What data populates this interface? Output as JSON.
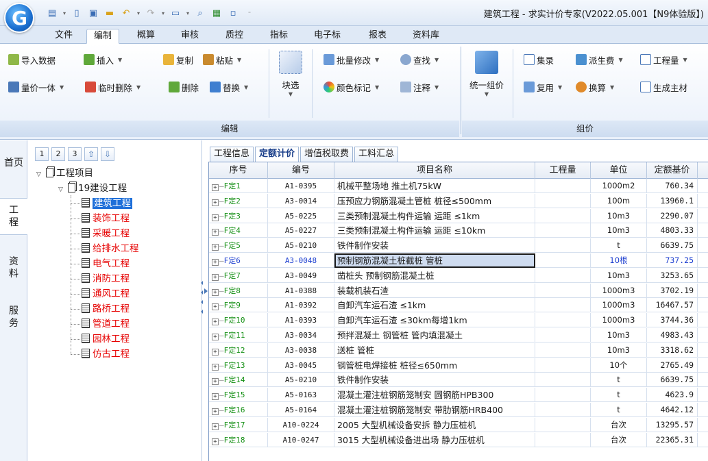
{
  "window": {
    "title": "建筑工程 - 求实计价专家(V2022.05.001【N9体验版】)"
  },
  "menu_tabs": [
    "文件",
    "编制",
    "概算",
    "审核",
    "质控",
    "指标",
    "电子标",
    "报表",
    "资料库"
  ],
  "active_menu_tab": "编制",
  "ribbon": {
    "edit_group": {
      "label": "编辑",
      "import_data": "导入数据",
      "insert": "插入",
      "copy": "复制",
      "paste": "粘贴",
      "quantity_price": "量价一体",
      "temp_delete": "临时删除",
      "delete": "删除",
      "replace": "替换",
      "block_select": "块选",
      "batch_modify": "批量修改",
      "find": "查找",
      "color_mark": "颜色标记",
      "annotate": "注释"
    },
    "price_group": {
      "label": "组价",
      "unified_pricing": "统一组价",
      "collect": "集录",
      "derived_fee": "派生费",
      "quantity": "工程量",
      "reuse": "复用",
      "convert": "换算",
      "gen_material": "生成主材"
    }
  },
  "left_strip": [
    "首页",
    "工程",
    "资料",
    "服务"
  ],
  "tree_toolbar": [
    "1",
    "2",
    "3"
  ],
  "tree": {
    "root": "工程项目",
    "project": "19建设工程",
    "children": [
      "建筑工程",
      "装饰工程",
      "采暖工程",
      "给排水工程",
      "电气工程",
      "消防工程",
      "通风工程",
      "路桥工程",
      "管道工程",
      "园林工程",
      "仿古工程"
    ],
    "selected_index": 0
  },
  "sub_tabs": [
    "工程信息",
    "定额计价",
    "增值税取费",
    "工料汇总"
  ],
  "active_sub_tab": "定额计价",
  "grid": {
    "columns": [
      "序号",
      "编号",
      "项目名称",
      "工程量",
      "单位",
      "定额基价"
    ],
    "rows": [
      {
        "seq": "F定1",
        "code": "A1-0395",
        "name": "机械平整场地 推土机75kW",
        "qty": "",
        "unit": "1000m2",
        "price": "760.34"
      },
      {
        "seq": "F定2",
        "code": "A3-0014",
        "name": "压预应力钢筋混凝土管桩 桩径≤500mm",
        "qty": "",
        "unit": "100m",
        "price": "13960.1"
      },
      {
        "seq": "F定3",
        "code": "A5-0225",
        "name": "三类预制混凝土构件运输 运距 ≤1km",
        "qty": "",
        "unit": "10m3",
        "price": "2290.07"
      },
      {
        "seq": "F定4",
        "code": "A5-0227",
        "name": "三类预制混凝土构件运输 运距 ≤10km",
        "qty": "",
        "unit": "10m3",
        "price": "4803.33"
      },
      {
        "seq": "F定5",
        "code": "A5-0210",
        "name": "铁件制作安装",
        "qty": "",
        "unit": "t",
        "price": "6639.75"
      },
      {
        "seq": "F定6",
        "code": "A3-0048",
        "name": "预制钢筋混凝土桩截桩 管桩",
        "qty": "",
        "unit": "10根",
        "price": "737.25"
      },
      {
        "seq": "F定7",
        "code": "A3-0049",
        "name": "凿桩头 预制钢筋混凝土桩",
        "qty": "",
        "unit": "10m3",
        "price": "3253.65"
      },
      {
        "seq": "F定8",
        "code": "A1-0388",
        "name": "装载机装石渣",
        "qty": "",
        "unit": "1000m3",
        "price": "3702.19"
      },
      {
        "seq": "F定9",
        "code": "A1-0392",
        "name": "自卸汽车运石渣 ≤1km",
        "qty": "",
        "unit": "1000m3",
        "price": "16467.57"
      },
      {
        "seq": "F定10",
        "code": "A1-0393",
        "name": "自卸汽车运石渣 ≤30km每增1km",
        "qty": "",
        "unit": "1000m3",
        "price": "3744.36"
      },
      {
        "seq": "F定11",
        "code": "A3-0034",
        "name": "预拌混凝土 钢管桩 管内填混凝土",
        "qty": "",
        "unit": "10m3",
        "price": "4983.43"
      },
      {
        "seq": "F定12",
        "code": "A3-0038",
        "name": "送桩 管桩",
        "qty": "",
        "unit": "10m3",
        "price": "3318.62"
      },
      {
        "seq": "F定13",
        "code": "A3-0045",
        "name": "钢管桩电焊接桩 桩径≤650mm",
        "qty": "",
        "unit": "10个",
        "price": "2765.49"
      },
      {
        "seq": "F定14",
        "code": "A5-0210",
        "name": "铁件制作安装",
        "qty": "",
        "unit": "t",
        "price": "6639.75"
      },
      {
        "seq": "F定15",
        "code": "A5-0163",
        "name": "混凝土灌注桩钢筋笼制安 圆钢筋HPB300",
        "qty": "",
        "unit": "t",
        "price": "4623.9"
      },
      {
        "seq": "F定16",
        "code": "A5-0164",
        "name": "混凝土灌注桩钢筋笼制安 带肋钢筋HRB400",
        "qty": "",
        "unit": "t",
        "price": "4642.12"
      },
      {
        "seq": "F定17",
        "code": "A10-0224",
        "name": "2005 大型机械设备安拆 静力压桩机",
        "qty": "",
        "unit": "台次",
        "price": "13295.57"
      },
      {
        "seq": "F定18",
        "code": "A10-0247",
        "name": "3015 大型机械设备进出场 静力压桩机",
        "qty": "",
        "unit": "台次",
        "price": "22365.31"
      }
    ],
    "selected_row": 5,
    "marked_row": 7
  }
}
